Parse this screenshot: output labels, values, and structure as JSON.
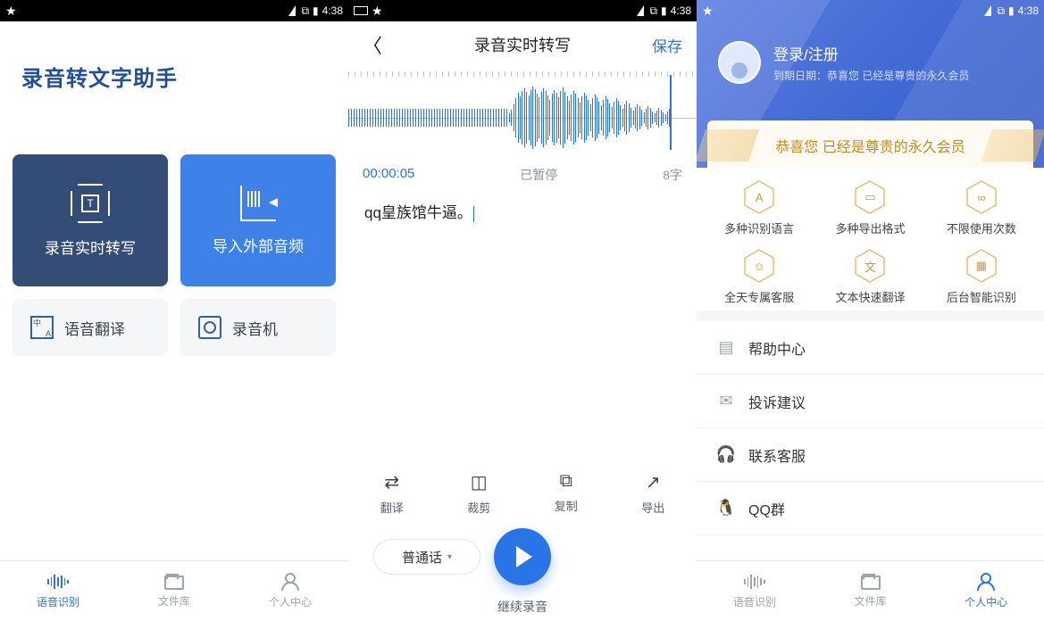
{
  "status": {
    "time": "4:38"
  },
  "screen1": {
    "title": "录音转文字助手",
    "cards": {
      "realtime": "录音实时转写",
      "import": "导入外部音频",
      "translate": "语音翻译",
      "recorder": "录音机"
    },
    "nav": {
      "voice": "语音识别",
      "files": "文件库",
      "me": "个人中心"
    }
  },
  "screen2": {
    "title": "录音实时转写",
    "save": "保存",
    "time": "00:00:05",
    "status": "已暂停",
    "wordcount": "8字",
    "transcript": "qq皇族馆牛逼。",
    "tools": {
      "translate": "翻译",
      "trim": "裁剪",
      "copy": "复制",
      "export": "导出"
    },
    "language": "普通话",
    "continue": "继续录音"
  },
  "screen3": {
    "login": "登录/注册",
    "expire_label": "到期日期：",
    "expire_value": "恭喜您 已经是尊贵的永久会员",
    "banner": "恭喜您 已经是尊贵的永久会员",
    "features": {
      "f1": "多种识别语言",
      "f2": "多种导出格式",
      "f3": "不限使用次数",
      "f4": "全天专属客服",
      "f5": "文本快速翻译",
      "f6": "后台智能识别"
    },
    "menu": {
      "help": "帮助中心",
      "feedback": "投诉建议",
      "contact": "联系客服",
      "qq": "QQ群"
    },
    "nav": {
      "voice": "语音识别",
      "files": "文件库",
      "me": "个人中心"
    }
  }
}
